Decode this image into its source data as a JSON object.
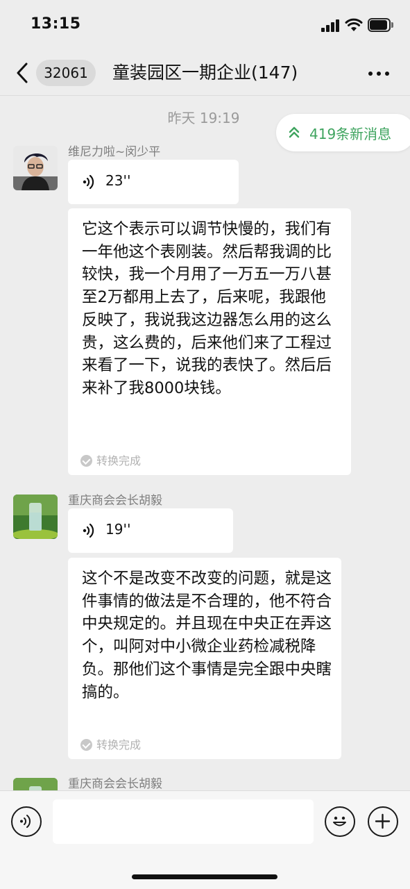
{
  "status_bar": {
    "time": "13:15"
  },
  "nav": {
    "unread_count": "32061",
    "title": "童装园区一期企业(147)"
  },
  "chat": {
    "timestamp": "昨天 19:19",
    "new_messages": "419条新消息",
    "messages": [
      {
        "sender": "维尼力啦~闵少平",
        "voice_duration": "23''",
        "transcript": "它这个表示可以调节快慢的，我们有一年他这个表刚装。然后帮我调的比较快，我一个月用了一万五一万八甚至2万都用上去了，后来呢，我跟他反映了，我说我这边器怎么用的这么贵，这么费的，后来他们来了工程过来看了一下，说我的表快了。然后后来补了我8000块钱。",
        "status": "转换完成"
      },
      {
        "sender": "重庆商会会长胡毅",
        "voice_duration": "19''",
        "transcript": "这个不是改变不改变的问题，就是这件事情的做法是不合理的，他不符合中央规定的。并且现在中央正在弄这个，叫阿对中小微企业药检减税降负。那他们这个事情是完全跟中央瞎搞的。",
        "status": "转换完成"
      },
      {
        "sender": "重庆商会会长胡毅"
      }
    ]
  },
  "input": {
    "placeholder": ""
  },
  "colors": {
    "background": "#EDEDED",
    "accent_green": "#3FA45F",
    "bubble": "#FFFFFF"
  }
}
